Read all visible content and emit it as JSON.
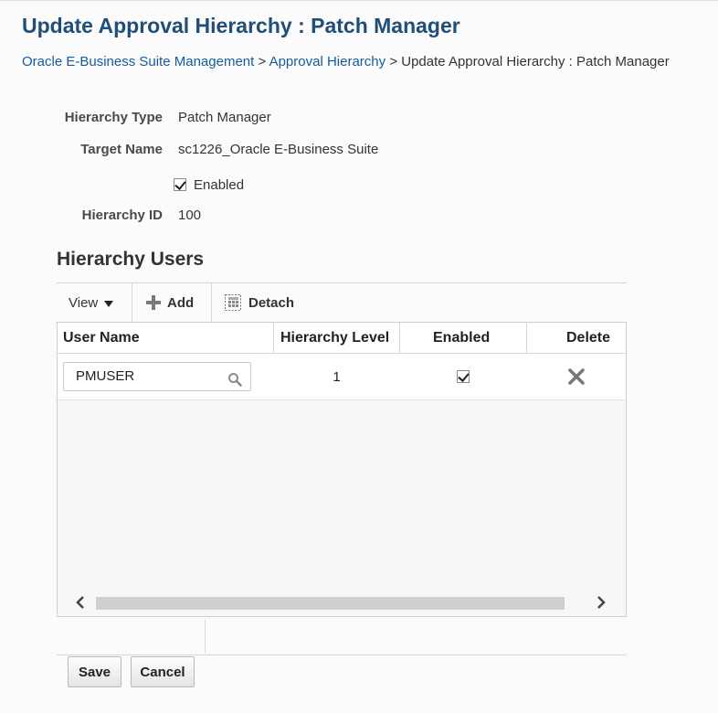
{
  "page": {
    "title": "Update Approval Hierarchy : Patch Manager"
  },
  "breadcrumb": {
    "items": [
      "Oracle E-Business Suite Management",
      "Approval Hierarchy"
    ],
    "separator": ">",
    "current": "Update Approval Hierarchy : Patch Manager"
  },
  "form": {
    "hierarchy_type_label": "Hierarchy Type",
    "hierarchy_type_value": "Patch Manager",
    "target_name_label": "Target Name",
    "target_name_value": "sc1226_Oracle E-Business Suite",
    "enabled_label": "Enabled",
    "enabled_checked": true,
    "hierarchy_id_label": "Hierarchy ID",
    "hierarchy_id_value": "100"
  },
  "section": {
    "title": "Hierarchy Users"
  },
  "toolbar": {
    "view_label": "View",
    "add_label": "Add",
    "detach_label": "Detach"
  },
  "table": {
    "columns": [
      "User Name",
      "Hierarchy Level",
      "Enabled",
      "Delete"
    ],
    "rows": [
      {
        "user_name": "PMUSER",
        "hierarchy_level": "1",
        "enabled": true
      }
    ]
  },
  "actions": {
    "save_label": "Save",
    "cancel_label": "Cancel"
  },
  "icons": {
    "add": "plus-icon",
    "detach": "detach-icon",
    "view": "chevron-down-icon",
    "search": "search-icon",
    "delete": "close-icon",
    "scroll_left": "chevron-left-icon",
    "scroll_right": "chevron-right-icon"
  },
  "colors": {
    "title": "#1f4e79",
    "link": "#145c9e",
    "background": "#fbfbfb"
  }
}
